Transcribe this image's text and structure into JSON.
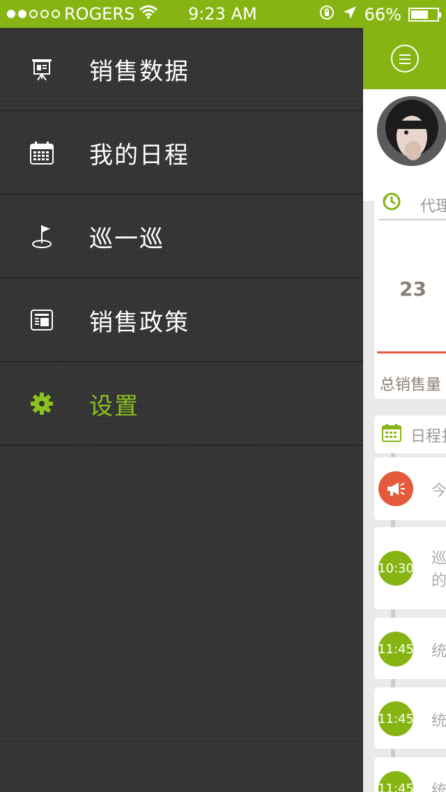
{
  "status_bar": {
    "carrier": "ROGERS",
    "time": "9:23 AM",
    "battery": "66%"
  },
  "menu": [
    {
      "label": "销售数据",
      "icon": "presentation-board-icon",
      "active": false
    },
    {
      "label": "我的日程",
      "icon": "calendar-icon",
      "active": false
    },
    {
      "label": "巡一巡",
      "icon": "flag-icon",
      "active": false
    },
    {
      "label": "销售政策",
      "icon": "document-icon",
      "active": false
    },
    {
      "label": "设置",
      "icon": "gear-icon",
      "active": true
    }
  ],
  "right_panel": {
    "card1": {
      "title": "代理铂",
      "number": "23",
      "total_label": "总销售量"
    },
    "card2": {
      "title": "日程扌"
    },
    "schedule": [
      {
        "time": "",
        "text": "今"
      },
      {
        "time": "10:30",
        "text": "巡\n的"
      },
      {
        "time": "11:45",
        "text": "统"
      },
      {
        "time": "11:45",
        "text": "统"
      },
      {
        "time": "11:45",
        "text": "统"
      }
    ]
  },
  "colors": {
    "brand_green": "#86b513",
    "menu_bg": "#333333",
    "accent_red": "#e45a3a"
  }
}
